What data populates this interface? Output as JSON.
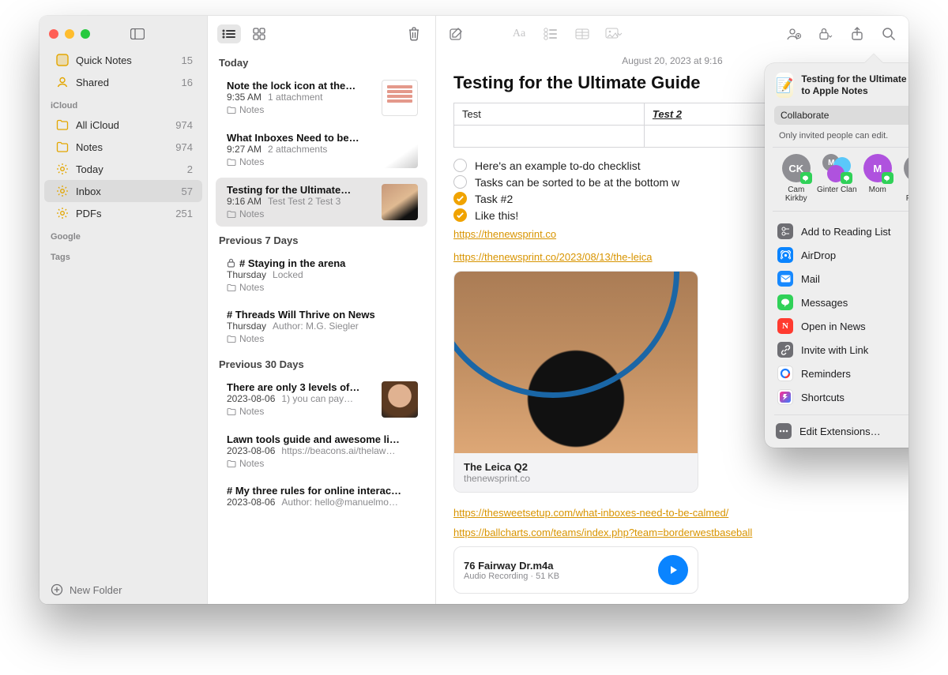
{
  "sidebar": {
    "quick_notes": {
      "label": "Quick Notes",
      "count": "15"
    },
    "shared": {
      "label": "Shared",
      "count": "16"
    },
    "icloud_heading": "iCloud",
    "folders": [
      {
        "label": "All iCloud",
        "count": "974"
      },
      {
        "label": "Notes",
        "count": "974"
      },
      {
        "label": "Today",
        "count": "2"
      },
      {
        "label": "Inbox",
        "count": "57",
        "selected": true
      },
      {
        "label": "PDFs",
        "count": "251"
      }
    ],
    "google_heading": "Google",
    "tags_heading": "Tags",
    "new_folder": "New Folder"
  },
  "list": {
    "groups": [
      {
        "heading": "Today",
        "items": [
          {
            "title": "Note the lock icon at the…",
            "time": "9:35 AM",
            "meta": "1 attachment",
            "folder": "Notes",
            "thumb": "doc"
          },
          {
            "title": "What Inboxes Need to be…",
            "time": "9:27 AM",
            "meta": "2 attachments",
            "folder": "Notes",
            "thumb": "attach"
          },
          {
            "title": "Testing for the Ultimate…",
            "time": "9:16 AM",
            "meta": "Test Test 2 Test 3",
            "folder": "Notes",
            "thumb": "photo",
            "selected": true
          }
        ]
      },
      {
        "heading": "Previous 7 Days",
        "items": [
          {
            "title": "# Staying in the arena",
            "time": "Thursday",
            "meta": "Locked",
            "folder": "Notes",
            "locked": true
          },
          {
            "title": "# Threads Will Thrive on News",
            "time": "Thursday",
            "meta": "Author: M.G. Siegler",
            "folder": "Notes"
          }
        ]
      },
      {
        "heading": "Previous 30 Days",
        "items": [
          {
            "title": "There are only 3 levels of…",
            "time": "2023-08-06",
            "meta": "1) you can pay…",
            "folder": "Notes",
            "thumb": "face"
          },
          {
            "title": "Lawn tools guide and awesome li…",
            "time": "2023-08-06",
            "meta": "https://beacons.ai/thelaw…",
            "folder": "Notes"
          },
          {
            "title": "# My three rules for online interac…",
            "time": "2023-08-06",
            "meta": "Author: hello@manuelmo…"
          }
        ]
      }
    ]
  },
  "note": {
    "date": "August 20, 2023 at 9:16",
    "title": "Testing for the Ultimate Guide",
    "table": {
      "c1": "Test",
      "c2": "Test 2"
    },
    "checklist": [
      {
        "done": false,
        "text": "Here's an example to-do checklist"
      },
      {
        "done": false,
        "text": "Tasks can be sorted to be at the bottom w"
      },
      {
        "done": true,
        "text": "Task #2"
      },
      {
        "done": true,
        "text": "Like this!"
      }
    ],
    "link1": "https://thenewsprint.co",
    "link2": "https://thenewsprint.co/2023/08/13/the-leica",
    "card": {
      "title": "The Leica Q2",
      "domain": "thenewsprint.co"
    },
    "link3": "https://thesweetsetup.com/what-inboxes-need-to-be-calmed/",
    "link4": "https://ballcharts.com/teams/index.php?team=borderwestbaseball",
    "audio": {
      "title": "76 Fairway Dr.m4a",
      "sub": "Audio Recording · 51 KB"
    }
  },
  "share": {
    "title": "Testing for the Ultimate Guide to Apple Notes",
    "mode": "Collaborate",
    "permission": "Only invited people can edit.",
    "people": [
      {
        "initials": "CK",
        "name": "Cam Kirkby",
        "color": "#8e8e93"
      },
      {
        "initials": "M",
        "name": "Ginter Clan",
        "color": "#a0a0a0",
        "cluster": true
      },
      {
        "initials": "M",
        "name": "Mom",
        "color": "#af52de"
      },
      {
        "initials": "JF",
        "name": "John Froese",
        "color": "#8e8e93"
      }
    ],
    "actions": [
      {
        "label": "Add to Reading List",
        "icon": "#6e6e73"
      },
      {
        "label": "AirDrop",
        "icon": "#0a84ff",
        "glyph": "airdrop"
      },
      {
        "label": "Mail",
        "icon": "#1789ff",
        "glyph": "mail"
      },
      {
        "label": "Messages",
        "icon": "#30d158",
        "glyph": "msg"
      },
      {
        "label": "Open in News",
        "icon": "#ff3b30",
        "glyph": "news"
      },
      {
        "label": "Invite with Link",
        "icon": "#6e6e73",
        "glyph": "link"
      },
      {
        "label": "Reminders",
        "icon": "#ffffff",
        "glyph": "reminders"
      },
      {
        "label": "Shortcuts",
        "icon": "#ffffff",
        "glyph": "shortcuts"
      }
    ],
    "edit": "Edit Extensions…"
  }
}
